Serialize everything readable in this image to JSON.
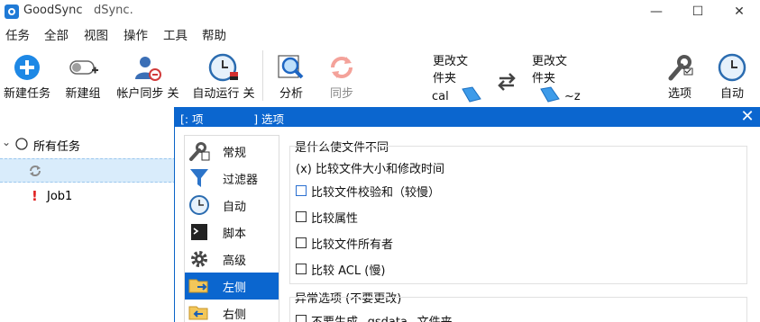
{
  "window": {
    "app_name": "GoodSync",
    "title_suffix": "dSync.",
    "buttons": {
      "minimize": "—",
      "maximize": "☐",
      "close": "✕"
    }
  },
  "menu": [
    "任务",
    "全部",
    "视图",
    "操作",
    "工具",
    "帮助"
  ],
  "toolbar": {
    "new_job": "新建任务",
    "new_group": "新建组",
    "account_sync": "帐户同步 关",
    "auto_run": "自动运行 关",
    "analyze": "分析",
    "sync": "同步",
    "left_change": "更改文件夹",
    "left_folder": "cal",
    "right_change": "更改文件夹",
    "right_folder": "~z",
    "options": "选项",
    "auto": "自动"
  },
  "tree": {
    "all_jobs": "所有任务",
    "job1": "Job1"
  },
  "dialog": {
    "title": "[: 项              ] 选项",
    "sidebar": [
      "常规",
      "过滤器",
      "自动",
      "脚本",
      "高级",
      "左侧",
      "右侧"
    ],
    "selected_index": 5,
    "group1_title": "是什么使文件不同",
    "group1_options": [
      {
        "label": "(x) 比较文件大小和修改时间",
        "checked": true,
        "kind": "radio-text"
      },
      {
        "label": "比较文件校验和（较慢）",
        "checked": false
      },
      {
        "label": "比较属性",
        "checked": false
      },
      {
        "label": "比较文件所有者",
        "checked": false
      },
      {
        "label": "比较 ACL (慢)",
        "checked": false
      }
    ],
    "group2_title": "异常选项 (不要更改)",
    "group2_options": [
      {
        "label": "不要生成 _gsdata_ 文件夹",
        "checked": false
      }
    ]
  },
  "colors": {
    "accent": "#0b66cf",
    "selection_bg": "#d9ecfb",
    "error": "#e02020"
  },
  "icons": {
    "new_job": "plus-circle-icon",
    "new_group": "group-icon",
    "account_sync": "user-sync-icon",
    "auto_run": "clock-icon",
    "analyze": "magnifier-icon",
    "sync": "sync-arrows-icon",
    "folder": "folder-icon",
    "swap": "swap-arrows-icon",
    "options": "wrench-icon",
    "auto": "clock-icon"
  }
}
